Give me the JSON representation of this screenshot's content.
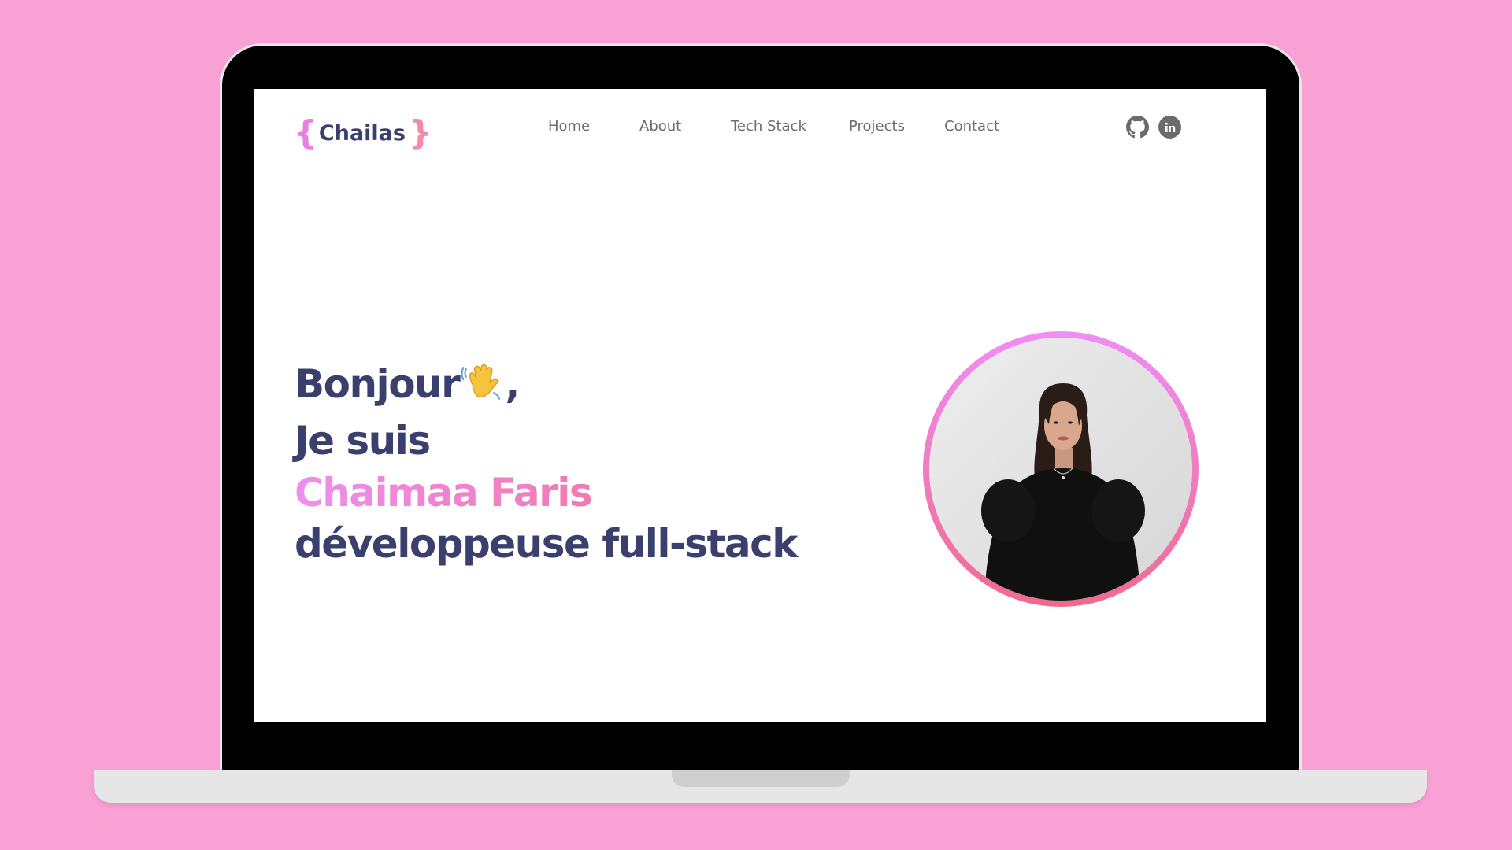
{
  "brand": {
    "brace_open": "{",
    "name": "Chailas",
    "brace_close": "}"
  },
  "nav": {
    "items": [
      {
        "label": "Home"
      },
      {
        "label": "About"
      },
      {
        "label": "Tech Stack"
      },
      {
        "label": "Projects"
      },
      {
        "label": "Contact"
      }
    ]
  },
  "social": {
    "github_icon": "github-icon",
    "linkedin_icon": "linkedin-icon"
  },
  "hero": {
    "greeting": "Bonjour",
    "greeting_emoji": "waving-hand-icon",
    "greeting_suffix": ",",
    "intro": "Je suis",
    "name": "Chaimaa Faris",
    "role": "développeuse full-stack"
  },
  "colors": {
    "page_background": "#f9a0d4",
    "heading": "#3a3f6e",
    "accent_pink": "#ee8ef0",
    "accent_rose": "#f07bb0",
    "nav_text": "#6b6b70"
  }
}
